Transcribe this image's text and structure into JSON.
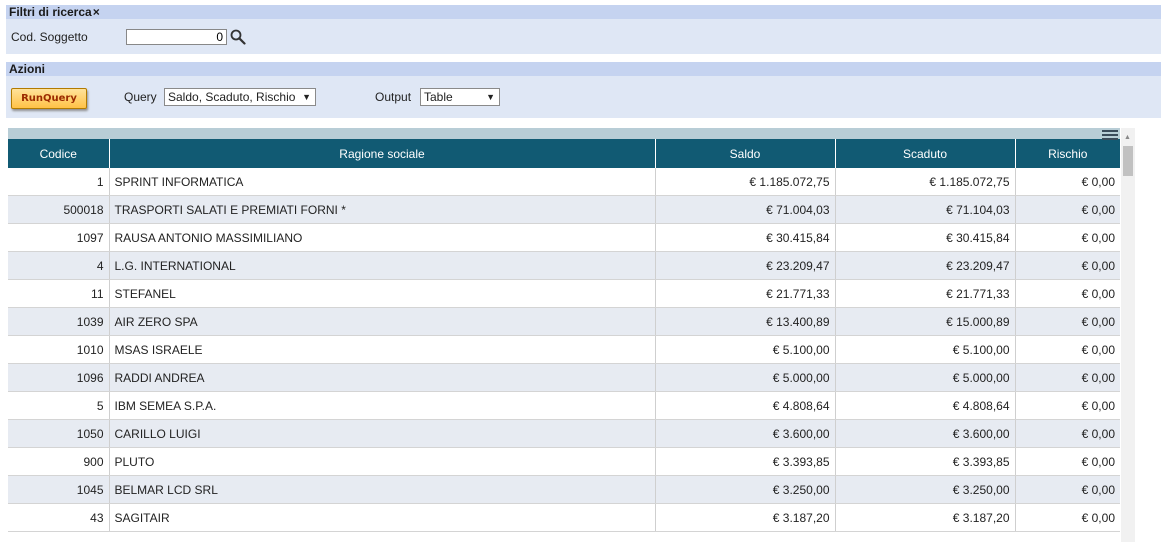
{
  "filters": {
    "title": "Filtri di ricerca",
    "close_icon": "×",
    "cod_soggetto_label": "Cod. Soggetto",
    "cod_soggetto_value": "0"
  },
  "actions": {
    "title": "Azioni",
    "run_button": "RunQuery",
    "query_label": "Query",
    "query_selected": "Saldo, Scaduto, Rischio",
    "output_label": "Output",
    "output_selected": "Table"
  },
  "table": {
    "headers": [
      "Codice",
      "Ragione sociale",
      "Saldo",
      "Scaduto",
      "Rischio"
    ],
    "rows": [
      {
        "codice": "1",
        "ragione": "SPRINT INFORMATICA",
        "saldo": "€ 1.185.072,75",
        "scaduto": "€ 1.185.072,75",
        "rischio": "€ 0,00"
      },
      {
        "codice": "500018",
        "ragione": "TRASPORTI SALATI E PREMIATI FORNI *",
        "saldo": "€ 71.004,03",
        "scaduto": "€ 71.104,03",
        "rischio": "€ 0,00"
      },
      {
        "codice": "1097",
        "ragione": "RAUSA ANTONIO MASSIMILIANO",
        "saldo": "€ 30.415,84",
        "scaduto": "€ 30.415,84",
        "rischio": "€ 0,00"
      },
      {
        "codice": "4",
        "ragione": "L.G. INTERNATIONAL",
        "saldo": "€ 23.209,47",
        "scaduto": "€ 23.209,47",
        "rischio": "€ 0,00"
      },
      {
        "codice": "11",
        "ragione": "STEFANEL",
        "saldo": "€ 21.771,33",
        "scaduto": "€ 21.771,33",
        "rischio": "€ 0,00"
      },
      {
        "codice": "1039",
        "ragione": "AIR ZERO SPA",
        "saldo": "€ 13.400,89",
        "scaduto": "€ 15.000,89",
        "rischio": "€ 0,00"
      },
      {
        "codice": "1010",
        "ragione": "MSAS ISRAELE",
        "saldo": "€ 5.100,00",
        "scaduto": "€ 5.100,00",
        "rischio": "€ 0,00"
      },
      {
        "codice": "1096",
        "ragione": "RADDI ANDREA",
        "saldo": "€ 5.000,00",
        "scaduto": "€ 5.000,00",
        "rischio": "€ 0,00"
      },
      {
        "codice": "5",
        "ragione": "IBM SEMEA S.P.A.",
        "saldo": "€ 4.808,64",
        "scaduto": "€ 4.808,64",
        "rischio": "€ 0,00"
      },
      {
        "codice": "1050",
        "ragione": "CARILLO LUIGI",
        "saldo": "€ 3.600,00",
        "scaduto": "€ 3.600,00",
        "rischio": "€ 0,00"
      },
      {
        "codice": "900",
        "ragione": "PLUTO",
        "saldo": "€ 3.393,85",
        "scaduto": "€ 3.393,85",
        "rischio": "€ 0,00"
      },
      {
        "codice": "1045",
        "ragione": "BELMAR LCD SRL",
        "saldo": "€ 3.250,00",
        "scaduto": "€ 3.250,00",
        "rischio": "€ 0,00"
      },
      {
        "codice": "43",
        "ragione": "SAGITAIR",
        "saldo": "€ 3.187,20",
        "scaduto": "€ 3.187,20",
        "rischio": "€ 0,00"
      }
    ]
  },
  "icons": {
    "search": "search-icon",
    "close": "close-icon",
    "menu": "hamburger-menu-icon",
    "dropdown": "chevron-down-icon"
  },
  "colors": {
    "header_bg": "#115a73",
    "section_head": "#c5d3f0",
    "section_body": "#dfe7f5",
    "button": "#ffc247"
  }
}
